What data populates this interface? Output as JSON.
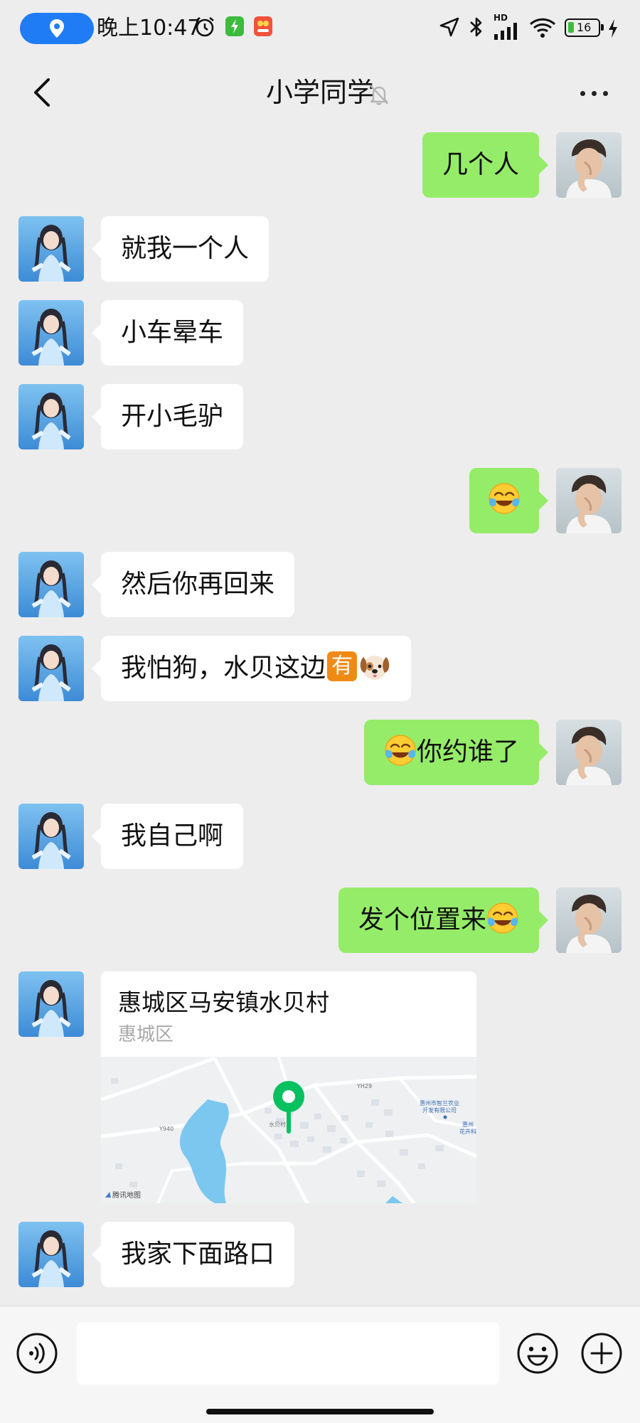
{
  "status_bar": {
    "time": "晚上10:47",
    "battery": "16",
    "network": "HD",
    "icons": [
      "location-pill-icon",
      "alarm-icon",
      "app-notification-icon",
      "app-notification-icon",
      "navigation-icon",
      "bluetooth-icon",
      "signal-icon",
      "wifi-icon",
      "battery-icon",
      "charging-icon"
    ]
  },
  "nav": {
    "title": "小学同学",
    "back_icon": "chevron-left-icon",
    "mute_icon": "bell-muted-icon",
    "more_icon": "more-horizontal-icon"
  },
  "messages": [
    {
      "side": "out",
      "text": "几个人"
    },
    {
      "side": "in",
      "text": "就我一个人"
    },
    {
      "side": "in",
      "text": "小车晕车"
    },
    {
      "side": "in",
      "text": "开小毛驴"
    },
    {
      "side": "out",
      "text": "",
      "emoji": "crying-laughing-emoji"
    },
    {
      "side": "in",
      "text": "然后你再回来"
    },
    {
      "side": "in",
      "text": "我怕狗，水贝这边",
      "badge": "有",
      "emoji": "dog-face-emoji"
    },
    {
      "side": "out",
      "text": "你约谁了",
      "emoji": "crying-laughing-emoji"
    },
    {
      "side": "in",
      "text": "我自己啊"
    },
    {
      "side": "out",
      "text": "发个位置来",
      "emoji": "crying-laughing-emoji"
    },
    {
      "side": "in",
      "type": "location",
      "title": "惠城区马安镇水贝村",
      "subtitle": "惠城区"
    },
    {
      "side": "in",
      "text": "我家下面路口"
    }
  ],
  "map": {
    "labels": {
      "road_y940": "Y940",
      "road_yh29": "YH29",
      "village": "水贝村",
      "company_line1": "惠州市智兰农业",
      "company_line2": "开发有限公司",
      "place_right_line1": "惠州",
      "place_right_line2": "花卉科",
      "provider": "腾讯地图"
    },
    "pin_color": "#07c160"
  },
  "input_bar": {
    "placeholder": "",
    "voice_icon": "voice-icon",
    "emoji_icon": "emoji-icon",
    "plus_icon": "plus-circle-icon"
  },
  "colors": {
    "background": "#ededed",
    "outgoing_bubble": "#95ec69",
    "incoming_bubble": "#ffffff",
    "location_pill": "#1f7cf5"
  }
}
